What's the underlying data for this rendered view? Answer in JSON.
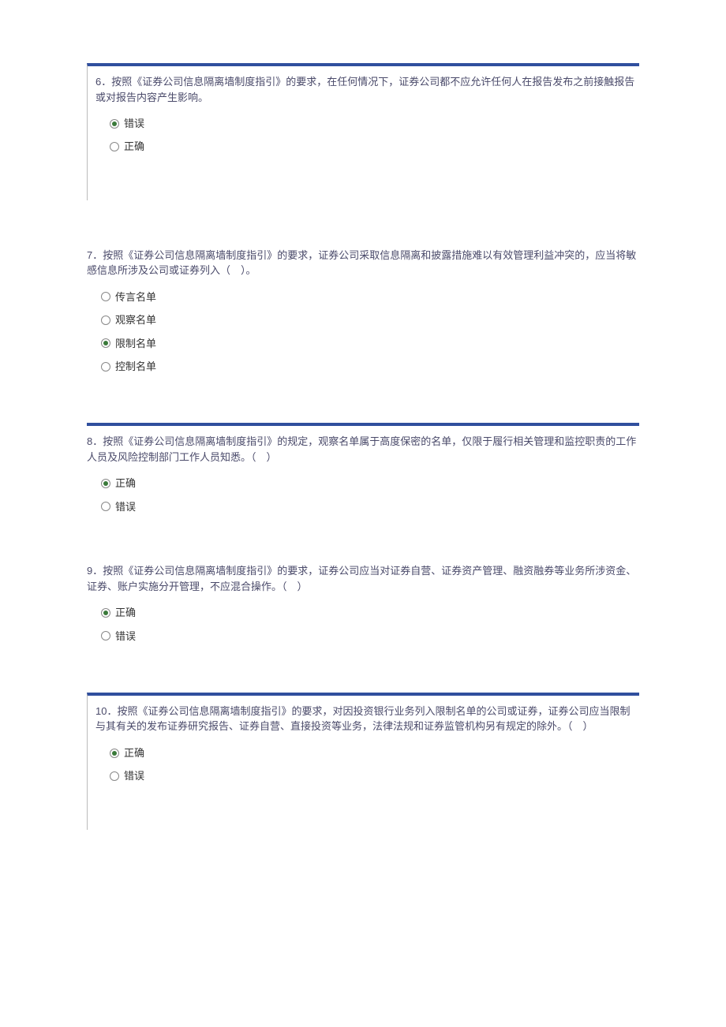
{
  "questions": [
    {
      "number": "6．",
      "text": "按照《证券公司信息隔离墙制度指引》的要求，在任何情况下，证券公司都不应允许任何人在报告发布之前接触报告或对报告内容产生影响。",
      "with_bar": true,
      "with_left": true,
      "options": [
        {
          "label": "错误",
          "selected": true
        },
        {
          "label": "正确",
          "selected": false
        }
      ]
    },
    {
      "number": "7．",
      "text": "按照《证券公司信息隔离墙制度指引》的要求，证券公司采取信息隔离和披露措施难以有效管理利益冲突的，应当将敏感信息所涉及公司或证券列入（　）。",
      "with_bar": false,
      "with_left": false,
      "options": [
        {
          "label": "传言名单",
          "selected": false
        },
        {
          "label": "观察名单",
          "selected": false
        },
        {
          "label": "限制名单",
          "selected": true
        },
        {
          "label": "控制名单",
          "selected": false
        }
      ]
    },
    {
      "number": "8．",
      "text": "按照《证券公司信息隔离墙制度指引》的规定，观察名单属于高度保密的名单，仅限于履行相关管理和监控职责的工作人员及风险控制部门工作人员知悉。（　）",
      "with_bar": true,
      "with_left": false,
      "options": [
        {
          "label": "正确",
          "selected": true
        },
        {
          "label": "错误",
          "selected": false
        }
      ]
    },
    {
      "number": "9．",
      "text": "按照《证券公司信息隔离墙制度指引》的要求，证券公司应当对证券自营、证券资产管理、融资融券等业务所涉资金、证券、账户实施分开管理，不应混合操作。（　）",
      "with_bar": false,
      "with_left": false,
      "options": [
        {
          "label": "正确",
          "selected": true
        },
        {
          "label": "错误",
          "selected": false
        }
      ]
    },
    {
      "number": "10．",
      "text": "按照《证券公司信息隔离墙制度指引》的要求，对因投资银行业务列入限制名单的公司或证券，证券公司应当限制与其有关的发布证券研究报告、证券自营、直接投资等业务，法律法规和证券监管机构另有规定的除外。（　）",
      "with_bar": true,
      "with_left": true,
      "options": [
        {
          "label": "正确",
          "selected": true
        },
        {
          "label": "错误",
          "selected": false
        }
      ]
    }
  ]
}
